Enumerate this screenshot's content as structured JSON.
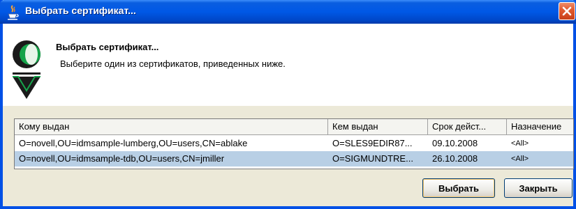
{
  "window": {
    "title": "Выбрать сертификат..."
  },
  "header": {
    "title": "Выбрать сертификат...",
    "description": "Выберите один из сертификатов, приведенных ниже."
  },
  "table": {
    "columns": [
      "Кому выдан",
      "Кем выдан",
      "Срок дейст...",
      "Назначение"
    ],
    "rows": [
      [
        "O=novell,OU=idmsample-lumberg,OU=users,CN=ablake",
        "O=SLES9EDIR87...",
        "09.10.2008",
        "<All>"
      ],
      [
        "O=novell,OU=idmsample-tdb,OU=users,CN=jmiller",
        "O=SIGMUNDTRE...",
        "26.10.2008",
        "<All>"
      ]
    ],
    "selected_row": 1
  },
  "buttons": {
    "select_label": "Выбрать",
    "close_label": "Закрыть"
  },
  "icons": {
    "titlebar": "java-icon",
    "close": "close-icon",
    "logo": "certificate-logo-icon"
  },
  "colors": {
    "titlebar": "#0058e6",
    "selection": "#b8cfe5",
    "close_button": "#e25b30"
  }
}
